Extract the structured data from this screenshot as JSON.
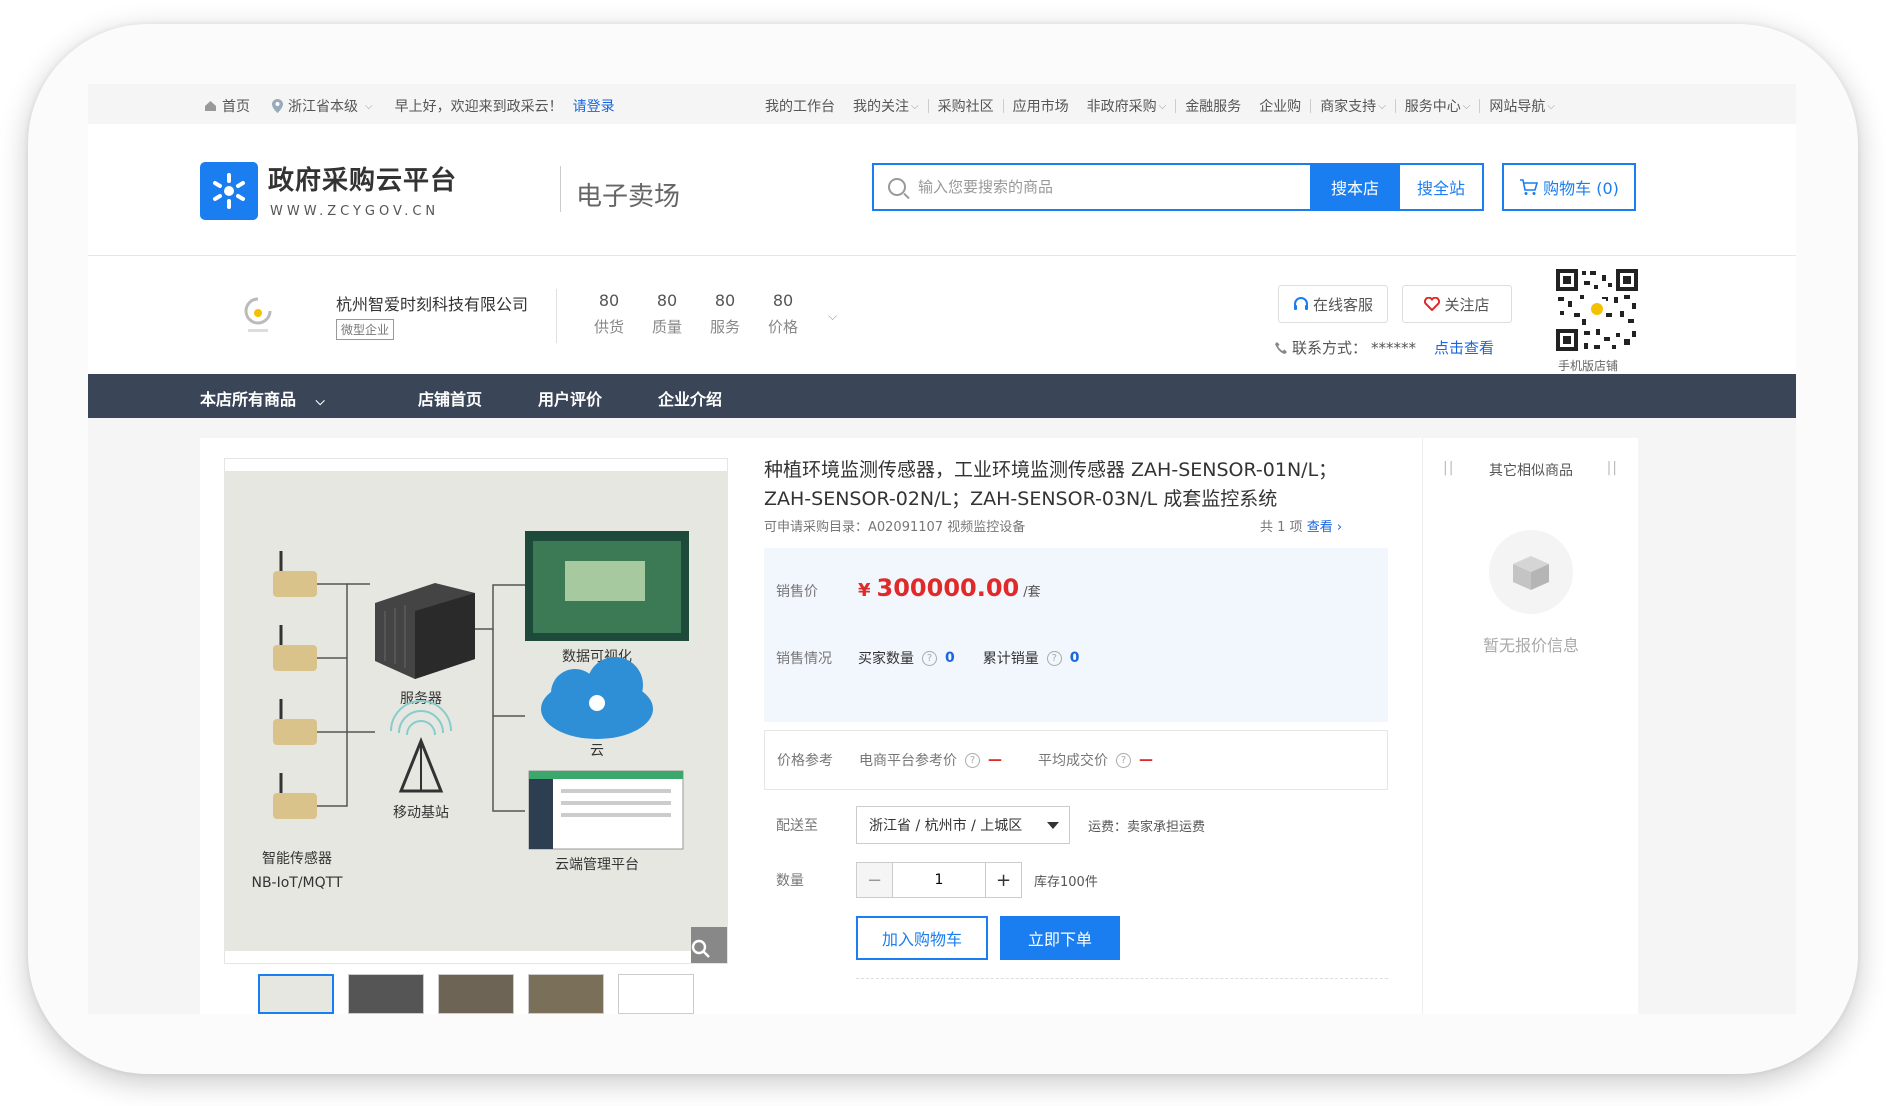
{
  "topbar": {
    "home": "首页",
    "region": "浙江省本级",
    "greeting": "早上好，欢迎来到政采云！",
    "login": "请登录",
    "links": [
      "我的工作台",
      "我的关注",
      "采购社区",
      "应用市场",
      "非政府采购",
      "金融服务",
      "企业购",
      "商家支持",
      "服务中心",
      "网站导航"
    ]
  },
  "header": {
    "brand": "政府采购云平台",
    "url": "WWW.ZCYGOV.CN",
    "market": "电子卖场",
    "search_placeholder": "输入您要搜索的商品",
    "search_store": "搜本店",
    "search_all": "搜全站",
    "cart": "购物车 (0)"
  },
  "shop": {
    "name": "杭州智爱时刻科技有限公司",
    "tag": "微型企业",
    "scores": [
      {
        "value": "80",
        "label": "供货"
      },
      {
        "value": "80",
        "label": "质量"
      },
      {
        "value": "80",
        "label": "服务"
      },
      {
        "value": "80",
        "label": "价格"
      }
    ],
    "customer_service": "在线客服",
    "follow": "关注店",
    "contact_label": "联系方式：",
    "contact_value": "******",
    "contact_link": "点击查看",
    "qr_label": "手机版店铺"
  },
  "nav": {
    "all_products": "本店所有商品",
    "home": "店铺首页",
    "reviews": "用户评价",
    "intro": "企业介绍"
  },
  "gallery": {
    "labels": {
      "server": "服务器",
      "base_station": "移动基站",
      "sensor": "智能传感器",
      "protocol": "NB-IoT/MQTT",
      "visual": "数据可视化",
      "cloud": "云",
      "platform": "云端管理平台"
    }
  },
  "product": {
    "title": "种植环境监测传感器，工业环境监测传感器 ZAH-SENSOR-01N/L；ZAH-SENSOR-02N/L；ZAH-SENSOR-03N/L 成套监控系统",
    "category": "可申请采购目录：A02091107 视频监控设备",
    "count_text": "共 1 项",
    "count_link": "查看",
    "price_label": "销售价",
    "currency": "¥",
    "price": "300000.00",
    "unit": "/套",
    "sales_label": "销售情况",
    "buyers_label": "买家数量",
    "buyers": "0",
    "total_label": "累计销量",
    "total": "0",
    "ref_label": "价格参考",
    "ref_ecom": "电商平台参考价",
    "ref_avg": "平均成交价",
    "dash": "—",
    "ship_label": "配送至",
    "ship_value": "浙江省 / 杭州市 / 上城区",
    "freight": "运费：卖家承担运费",
    "qty_label": "数量",
    "qty": "1",
    "stock": "库存100件",
    "add_cart": "加入购物车",
    "buy_now": "立即下单"
  },
  "side": {
    "title": "其它相似商品",
    "bars": "||",
    "empty": "暂无报价信息"
  },
  "colors": {
    "accent": "#1a7ef0",
    "nav_bg": "#3b4558",
    "price": "#e02a2a"
  }
}
